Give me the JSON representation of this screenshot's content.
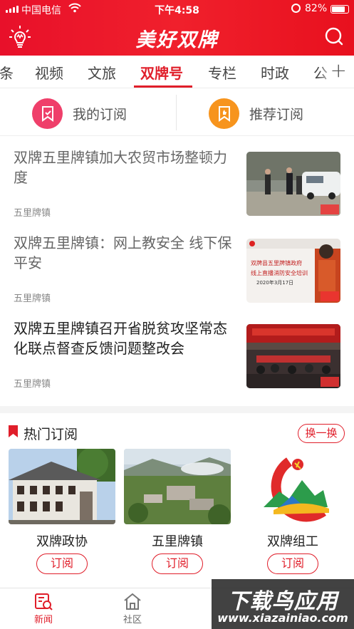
{
  "status_bar": {
    "carrier": "中国电信",
    "time": "下午4:58",
    "battery": "82%",
    "battery_level": 0.82,
    "icons": [
      "signal-icon",
      "wifi-icon",
      "orientation-lock-icon",
      "battery-icon"
    ]
  },
  "app_bar": {
    "logo": "美好双牌",
    "left_icon": "lightbulb-icon",
    "right_icon": "search-icon"
  },
  "tabs": {
    "items": [
      {
        "label": "条"
      },
      {
        "label": "视频"
      },
      {
        "label": "文旅"
      },
      {
        "label": "双牌号"
      },
      {
        "label": "专栏"
      },
      {
        "label": "时政"
      },
      {
        "label": "公"
      }
    ],
    "active_index": 3,
    "add_label": "+"
  },
  "subscriptions": {
    "mine": {
      "label": "我的订阅",
      "icon": "bookmark-check-icon",
      "color": "#ef3f6a"
    },
    "recommended": {
      "label": "推荐订阅",
      "icon": "bookmark-thumb-icon",
      "color": "#f7941d"
    }
  },
  "news": [
    {
      "title": "双牌五里牌镇加大农贸市场整顿力度",
      "source": "五里牌镇",
      "read": true
    },
    {
      "title": "双牌五里牌镇：网上教安全 线下保平安",
      "source": "五里牌镇",
      "read": true
    },
    {
      "title": "双牌五里牌镇召开省脱贫攻坚常态化联点督查反馈问题整改会",
      "source": "五里牌镇",
      "read": false
    }
  ],
  "thumb_text": {
    "line1": "双牌县五里牌镇政府",
    "line2": "线上直播消防安全培训",
    "date": "2020年3月17日",
    "badge": "新"
  },
  "hot": {
    "title": "热门订阅",
    "refresh_label": "换一换",
    "cards": [
      {
        "name": "双牌政协",
        "button": "订阅"
      },
      {
        "name": "五里牌镇",
        "button": "订阅"
      },
      {
        "name": "双牌组工",
        "button": "订阅"
      }
    ]
  },
  "bottom_nav": {
    "items": [
      {
        "label": "新闻",
        "icon": "news-icon",
        "active": true
      },
      {
        "label": "社区",
        "icon": "home-icon",
        "active": false
      }
    ]
  },
  "watermark": {
    "line1": "下载鸟应用",
    "line2": "www.xiazainiao.com"
  },
  "colors": {
    "brand_red": "#e01e2a",
    "header_red": "#ec1628"
  }
}
